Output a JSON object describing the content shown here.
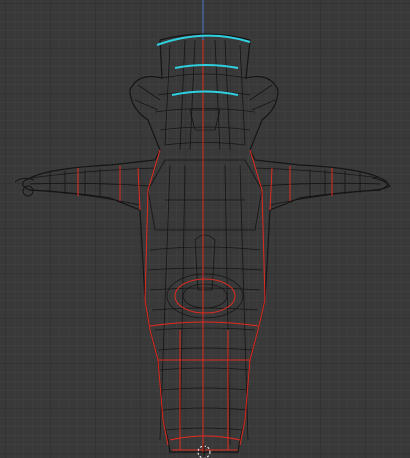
{
  "viewport": {
    "background": "#393939",
    "grid_minor_color": "#434343",
    "grid_major_color": "#2e2e2e",
    "axis_z_color": "#4a78c8"
  },
  "mesh": {
    "wire_color": "#111111",
    "seam_color": "#e02a20",
    "selected_color": "#2fd0e0",
    "origin_marker": "pivot-icon",
    "view": "front-orthographic"
  }
}
